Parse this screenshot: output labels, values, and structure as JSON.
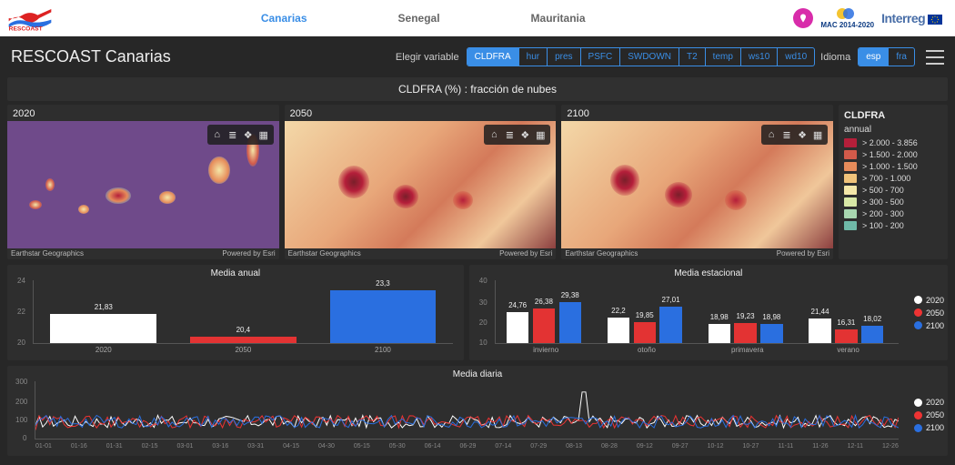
{
  "topnav": {
    "canarias": "Canarias",
    "senegal": "Senegal",
    "mauritania": "Mauritania"
  },
  "partners": {
    "mac": "MAC 2014-2020",
    "interreg": "Interreg"
  },
  "header": {
    "title": "RESCOAST Canarias",
    "choose_var": "Elegir variable",
    "idioma": "Idioma"
  },
  "vars": [
    "CLDFRA",
    "hur",
    "pres",
    "PSFC",
    "SWDOWN",
    "T2",
    "temp",
    "ws10",
    "wd10"
  ],
  "langs": [
    "esp",
    "fra"
  ],
  "banner": "CLDFRA (%) : fracción de nubes",
  "map_years": [
    "2020",
    "2050",
    "2100"
  ],
  "credit_left": "Earthstar Geographics",
  "credit_right": "Powered by Esri",
  "legend": {
    "title": "CLDFRA",
    "sub": "annual",
    "items": [
      {
        "c": "#b51f3a",
        "t": "> 2.000 - 3.856"
      },
      {
        "c": "#d25a4a",
        "t": "> 1.500 - 2.000"
      },
      {
        "c": "#e68c5a",
        "t": "> 1.000 - 1.500"
      },
      {
        "c": "#f0c37a",
        "t": "> 700 - 1.000"
      },
      {
        "c": "#f4e7a8",
        "t": "> 500 - 700"
      },
      {
        "c": "#d8e8a6",
        "t": "> 300 - 500"
      },
      {
        "c": "#a8d7b0",
        "t": "> 200 - 300"
      },
      {
        "c": "#6fb9a8",
        "t": "> 100 - 200"
      }
    ]
  },
  "series": {
    "s2020": "2020",
    "s2050": "2050",
    "s2100": "2100"
  },
  "annual": {
    "title": "Media anual",
    "yticks": [
      "24",
      "22",
      "20"
    ],
    "cats": [
      "2020",
      "2050",
      "2100"
    ]
  },
  "seasonal": {
    "title": "Media estacional",
    "yticks": [
      "40",
      "30",
      "20",
      "10"
    ],
    "cats": [
      "invierno",
      "otoño",
      "primavera",
      "verano"
    ]
  },
  "daily": {
    "title": "Media diaria",
    "yticks": [
      "300",
      "200",
      "100",
      "0"
    ],
    "xticks": [
      "01-01",
      "01-16",
      "01-31",
      "02-15",
      "03-01",
      "03-16",
      "03-31",
      "04-15",
      "04-30",
      "05-15",
      "05-30",
      "06-14",
      "06-29",
      "07-14",
      "07-29",
      "08-13",
      "08-28",
      "09-12",
      "09-27",
      "10-12",
      "10-27",
      "11-11",
      "11-26",
      "12-11",
      "12-26"
    ]
  },
  "chart_data": [
    {
      "type": "bar",
      "title": "Media anual",
      "categories": [
        "2020",
        "2050",
        "2100"
      ],
      "values": [
        21.83,
        20.4,
        23.3
      ],
      "ylim": [
        20,
        24
      ],
      "colors": [
        "#ffffff",
        "#e33333",
        "#2a6fe0"
      ]
    },
    {
      "type": "bar",
      "title": "Media estacional",
      "categories": [
        "invierno",
        "otoño",
        "primavera",
        "verano"
      ],
      "series": [
        {
          "name": "2020",
          "values": [
            24.76,
            22.2,
            18.98,
            21.44
          ],
          "color": "#ffffff"
        },
        {
          "name": "2050",
          "values": [
            26.38,
            19.85,
            19.23,
            16.31
          ],
          "color": "#e33333"
        },
        {
          "name": "2100",
          "values": [
            29.38,
            27.01,
            18.98,
            18.02
          ],
          "color": "#2a6fe0"
        }
      ],
      "ylim": [
        10,
        40
      ]
    },
    {
      "type": "line",
      "title": "Media diaria",
      "x_range": [
        "01-01",
        "12-31"
      ],
      "series": [
        {
          "name": "2020",
          "color": "#ffffff"
        },
        {
          "name": "2050",
          "color": "#e33333"
        },
        {
          "name": "2100",
          "color": "#2a6fe0"
        }
      ],
      "ylim": [
        0,
        300
      ],
      "note": "daily values fluctuate mostly between ~10 and ~60 with an isolated spike near 230 around 08-20 for series 2020"
    }
  ]
}
